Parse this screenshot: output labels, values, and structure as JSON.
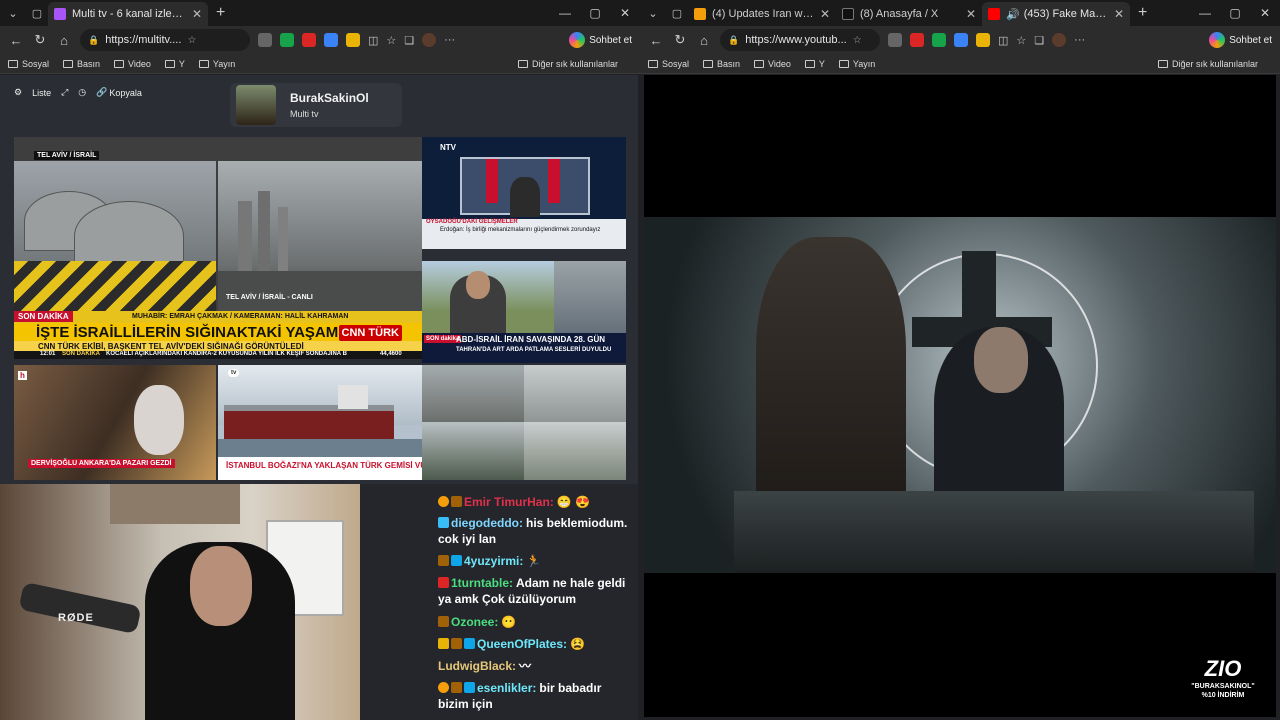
{
  "left_browser": {
    "tabs": [
      {
        "label": "Multi tv - 6 kanal izleniyor",
        "active": true
      }
    ],
    "url": "https://multitv....",
    "chat_button": "Sohbet et",
    "bookmarks": [
      "Sosyal",
      "Basın",
      "Video",
      "Y",
      "Yayın"
    ],
    "other_bookmarks": "Diğer sık kullanılanlar"
  },
  "right_browser": {
    "tabs": [
      {
        "label": "(4) Updates Iran war live: Trum",
        "active": false
      },
      {
        "label": "(8) Anasayfa / X",
        "active": false
      },
      {
        "label": "(453) Fake Majesty ft. Den",
        "active": true
      }
    ],
    "url": "https://www.youtub...",
    "chat_button": "Sohbet et",
    "bookmarks": [
      "Sosyal",
      "Basın",
      "Video",
      "Y",
      "Yayın"
    ],
    "other_bookmarks": "Diğer sık kullanılanlar"
  },
  "multitv": {
    "controls": {
      "list": "Liste",
      "copy": "Kopyala"
    },
    "profile": {
      "name": "BurakSakinOl",
      "subtitle": "Multi tv"
    },
    "cnn": {
      "location_tag": "TEL AVİV / İSRAİL",
      "live_tag": "TEL AVİV / İSRAİL - CANLI",
      "reporter_line": "MUHABİR: EMRAH ÇAKMAK / KAMERAMAN: HALİL KAHRAMAN",
      "breaking": "SON DAKİKA",
      "headline": "İŞTE İSRAİLLİLERİN SIĞINAKTAKİ YAŞAMI",
      "subheadline": "CNN TÜRK EKİBİ, BAŞKENT TEL AVİV'DEKİ SIĞINAĞI GÖRÜNTÜLEDİ",
      "ticker_time": "12:01",
      "ticker_label": "SON DAKİKA",
      "ticker_text": "KOCAELİ AÇIKLARINDAKİ KANDIRA-2 KUYUSUNDA YILIN İLK KEŞİF SONDAJINA B",
      "ticker_value": "44,4600",
      "logo": "CNN TÜRK"
    },
    "ntv": {
      "logo": "NTV",
      "strip": "OYSADOĞU'DAKİ GELİŞMELER",
      "line": "Erdoğan: İş birliği mekanizmalarını güçlendirmek zorundayız"
    },
    "reporter": {
      "breaking": "SON dakika",
      "headline": "ABD-İSRAİL İRAN SAVAŞINDA 28. GÜN",
      "subline": "TAHRAN'DA ART ARDA PATLAMA SESLERİ DUYULDU"
    },
    "tv100": {
      "caption": "DERVİŞOĞLU ANKARA'DA PAZARI GEZDİ"
    },
    "ship": {
      "caption": "İSTANBUL BOĞAZI'NA YAKLAŞAN TÜRK GEMİSİ VURULDU"
    }
  },
  "webcam": {
    "mic_brand": "RØDE"
  },
  "chat": {
    "messages": [
      {
        "user": "Emir TimurHan:",
        "text": "",
        "user_color": "#e0304a"
      },
      {
        "user": "diegodeddo:",
        "text": "his beklemiodum. cok iyi lan",
        "user_color": "#7fd7ff"
      },
      {
        "user": "4yuzyirmi:",
        "text": "",
        "user_color": "#6ee7f9"
      },
      {
        "user": "1turntable:",
        "text": "Adam ne hale geldi ya amk Çok üzülüyorum",
        "user_color": "#4ade80"
      },
      {
        "user": "Ozonee:",
        "text": "",
        "user_color": "#4ade80"
      },
      {
        "user": "QueenOfPlates:",
        "text": "",
        "user_color": "#6ee7f9"
      },
      {
        "user": "LudwigBlack:",
        "text": "",
        "user_color": "#e5c77a"
      },
      {
        "user": "esenlikler:",
        "text": "bir babadır bizim için",
        "user_color": "#6ee7f9"
      }
    ]
  },
  "overlay": {
    "logo": "ZIO",
    "promo_line1": "\"BURAKSAKINOL\"",
    "promo_line2": "%10 İNDİRİM"
  }
}
